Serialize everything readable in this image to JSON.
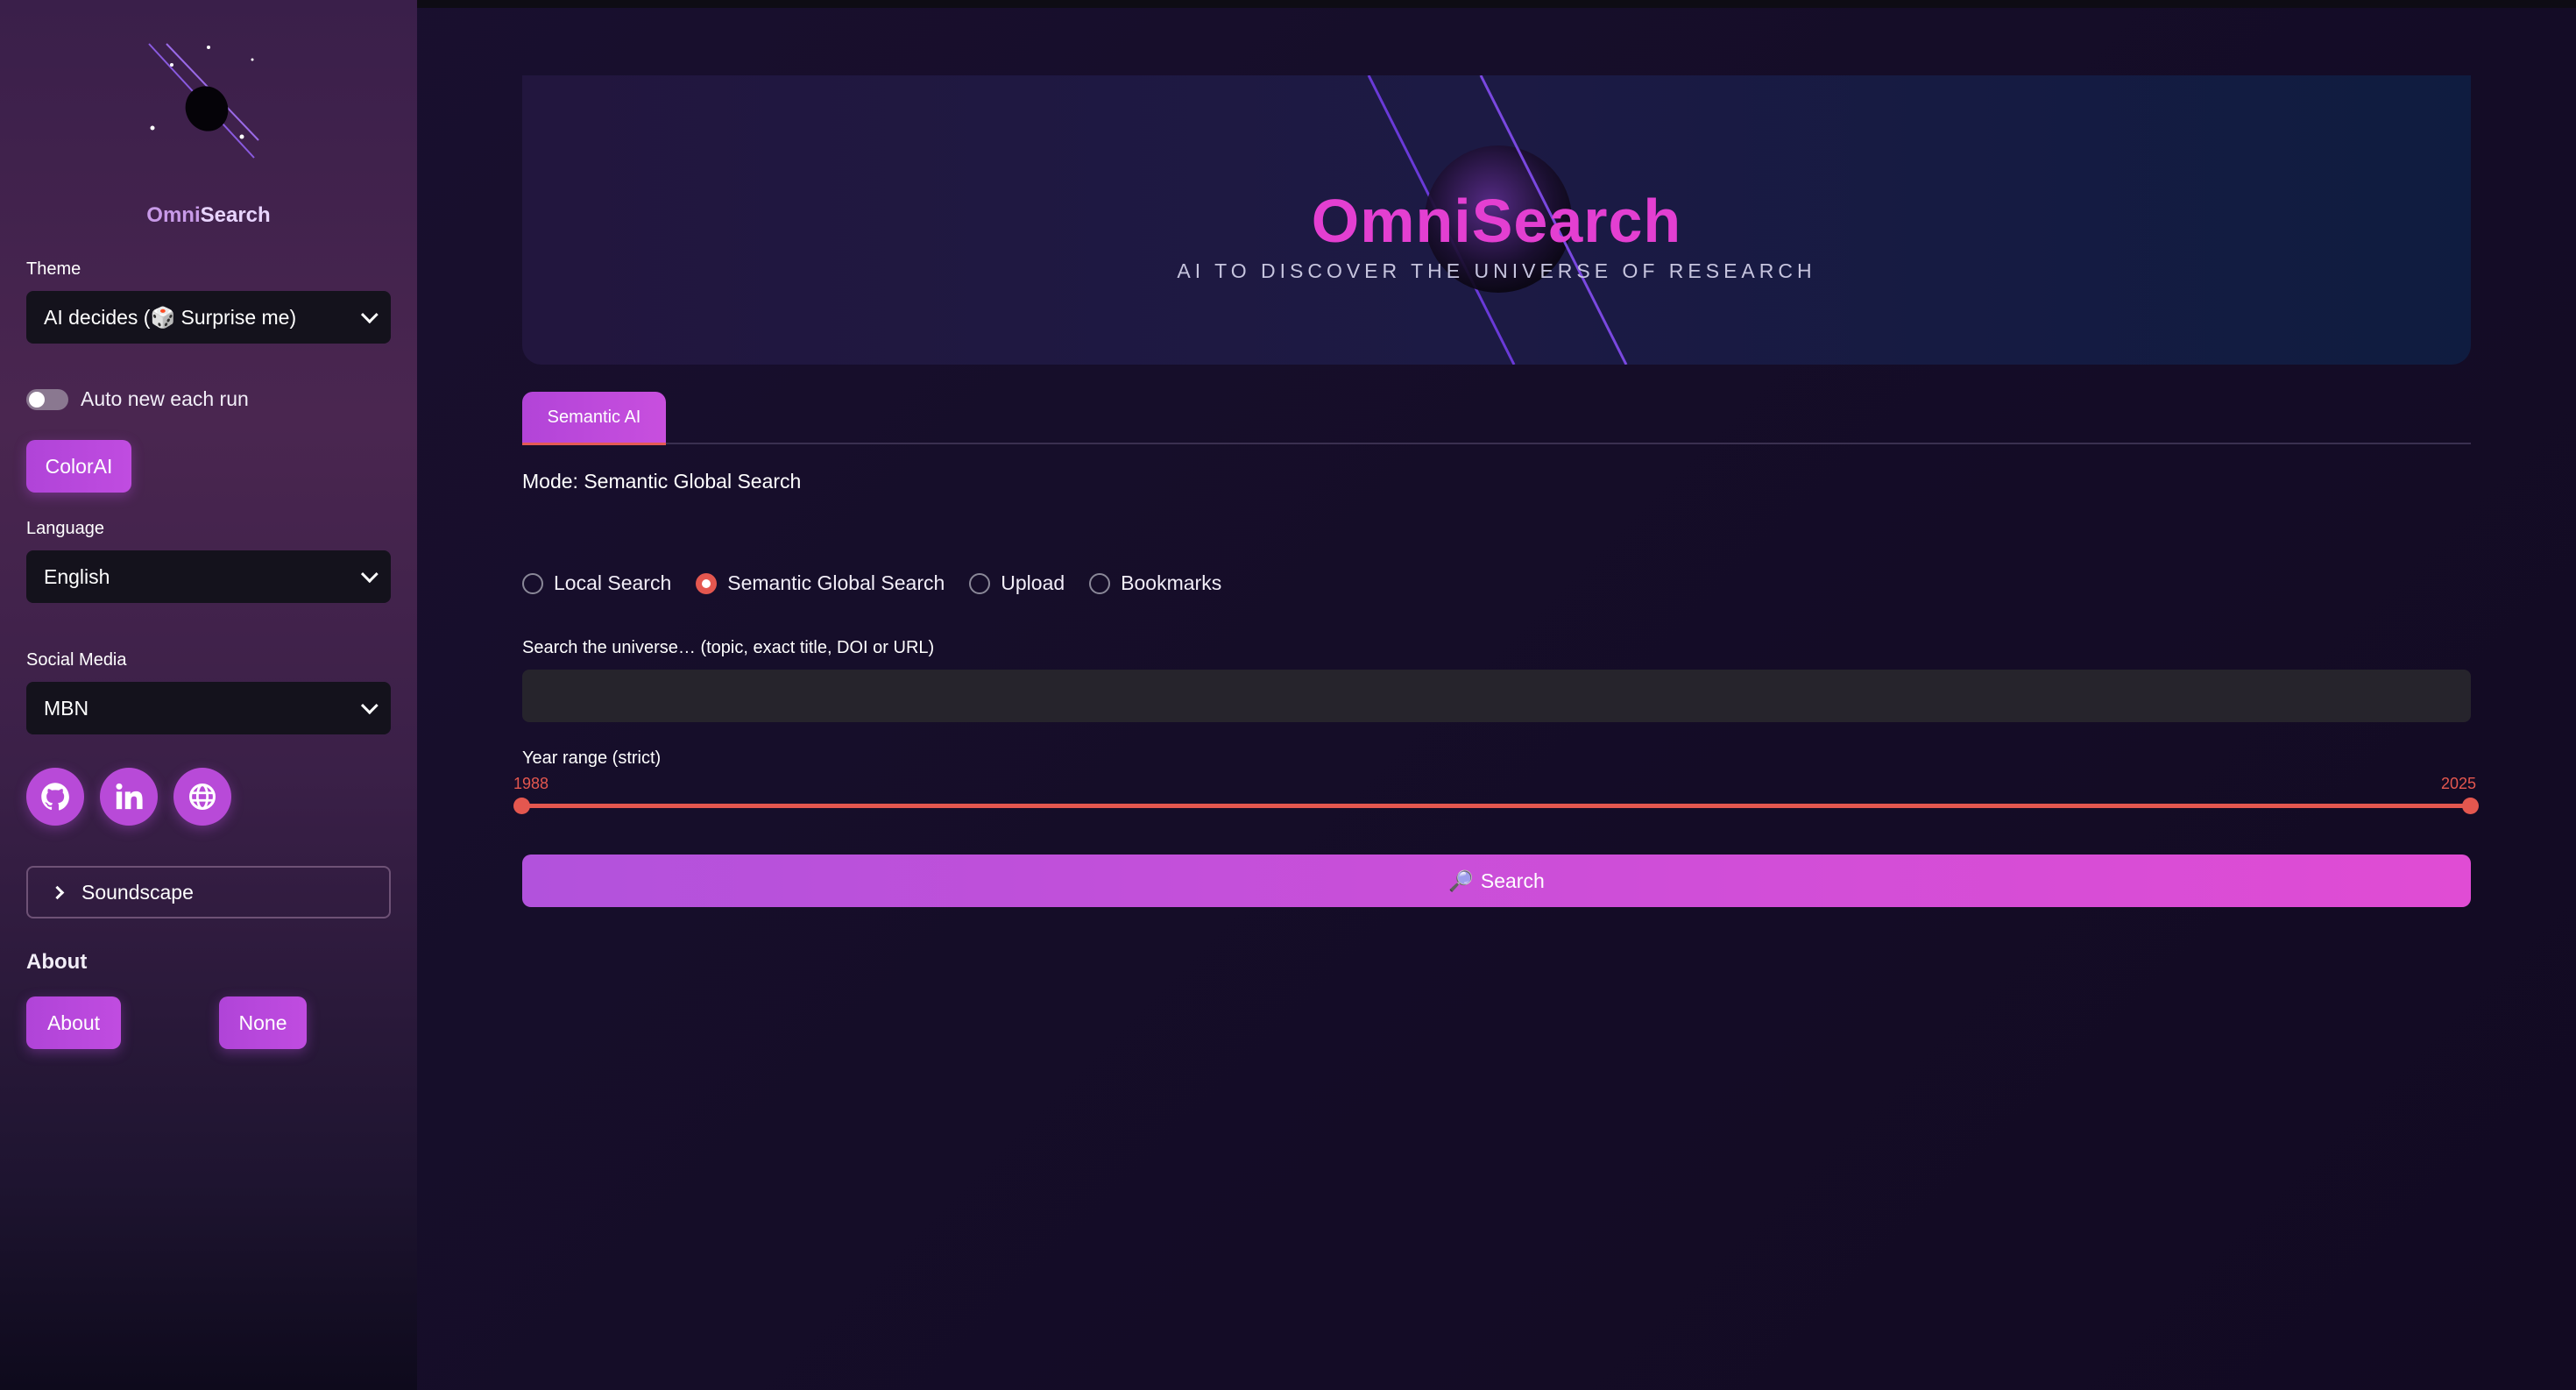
{
  "sidebar": {
    "brand_first": "Omni",
    "brand_second": "Search",
    "theme_label": "Theme",
    "theme_value": "AI decides (🎲 Surprise me)",
    "auto_toggle_label": "Auto new each run",
    "color_button": "ColorAI",
    "language_label": "Language",
    "language_value": "English",
    "social_label": "Social Media",
    "social_value": "MBN",
    "social_icons": [
      "github-icon",
      "linkedin-icon",
      "globe-icon"
    ],
    "soundscape_label": "Soundscape",
    "about_heading": "About",
    "about_button": "About",
    "none_button": "None"
  },
  "hero": {
    "title": "OmniSearch",
    "subtitle": "AI TO DISCOVER THE UNIVERSE OF RESEARCH"
  },
  "tabs": [
    {
      "label": "Semantic AI",
      "active": true
    }
  ],
  "mode_text": "Mode: Semantic Global Search",
  "radios": [
    {
      "label": "Local Search",
      "selected": false
    },
    {
      "label": "Semantic Global Search",
      "selected": true
    },
    {
      "label": "Upload",
      "selected": false
    },
    {
      "label": "Bookmarks",
      "selected": false
    }
  ],
  "search": {
    "label": "Search the universe… (topic, exact title, DOI or URL)",
    "value": "",
    "placeholder": ""
  },
  "year_range": {
    "label": "Year range (strict)",
    "min": "1988",
    "max": "2025"
  },
  "search_button": {
    "icon": "🔎",
    "label": "Search"
  },
  "colors": {
    "accent": "#c04ce0",
    "slider": "#e4574f",
    "title": "#e33fd1"
  }
}
